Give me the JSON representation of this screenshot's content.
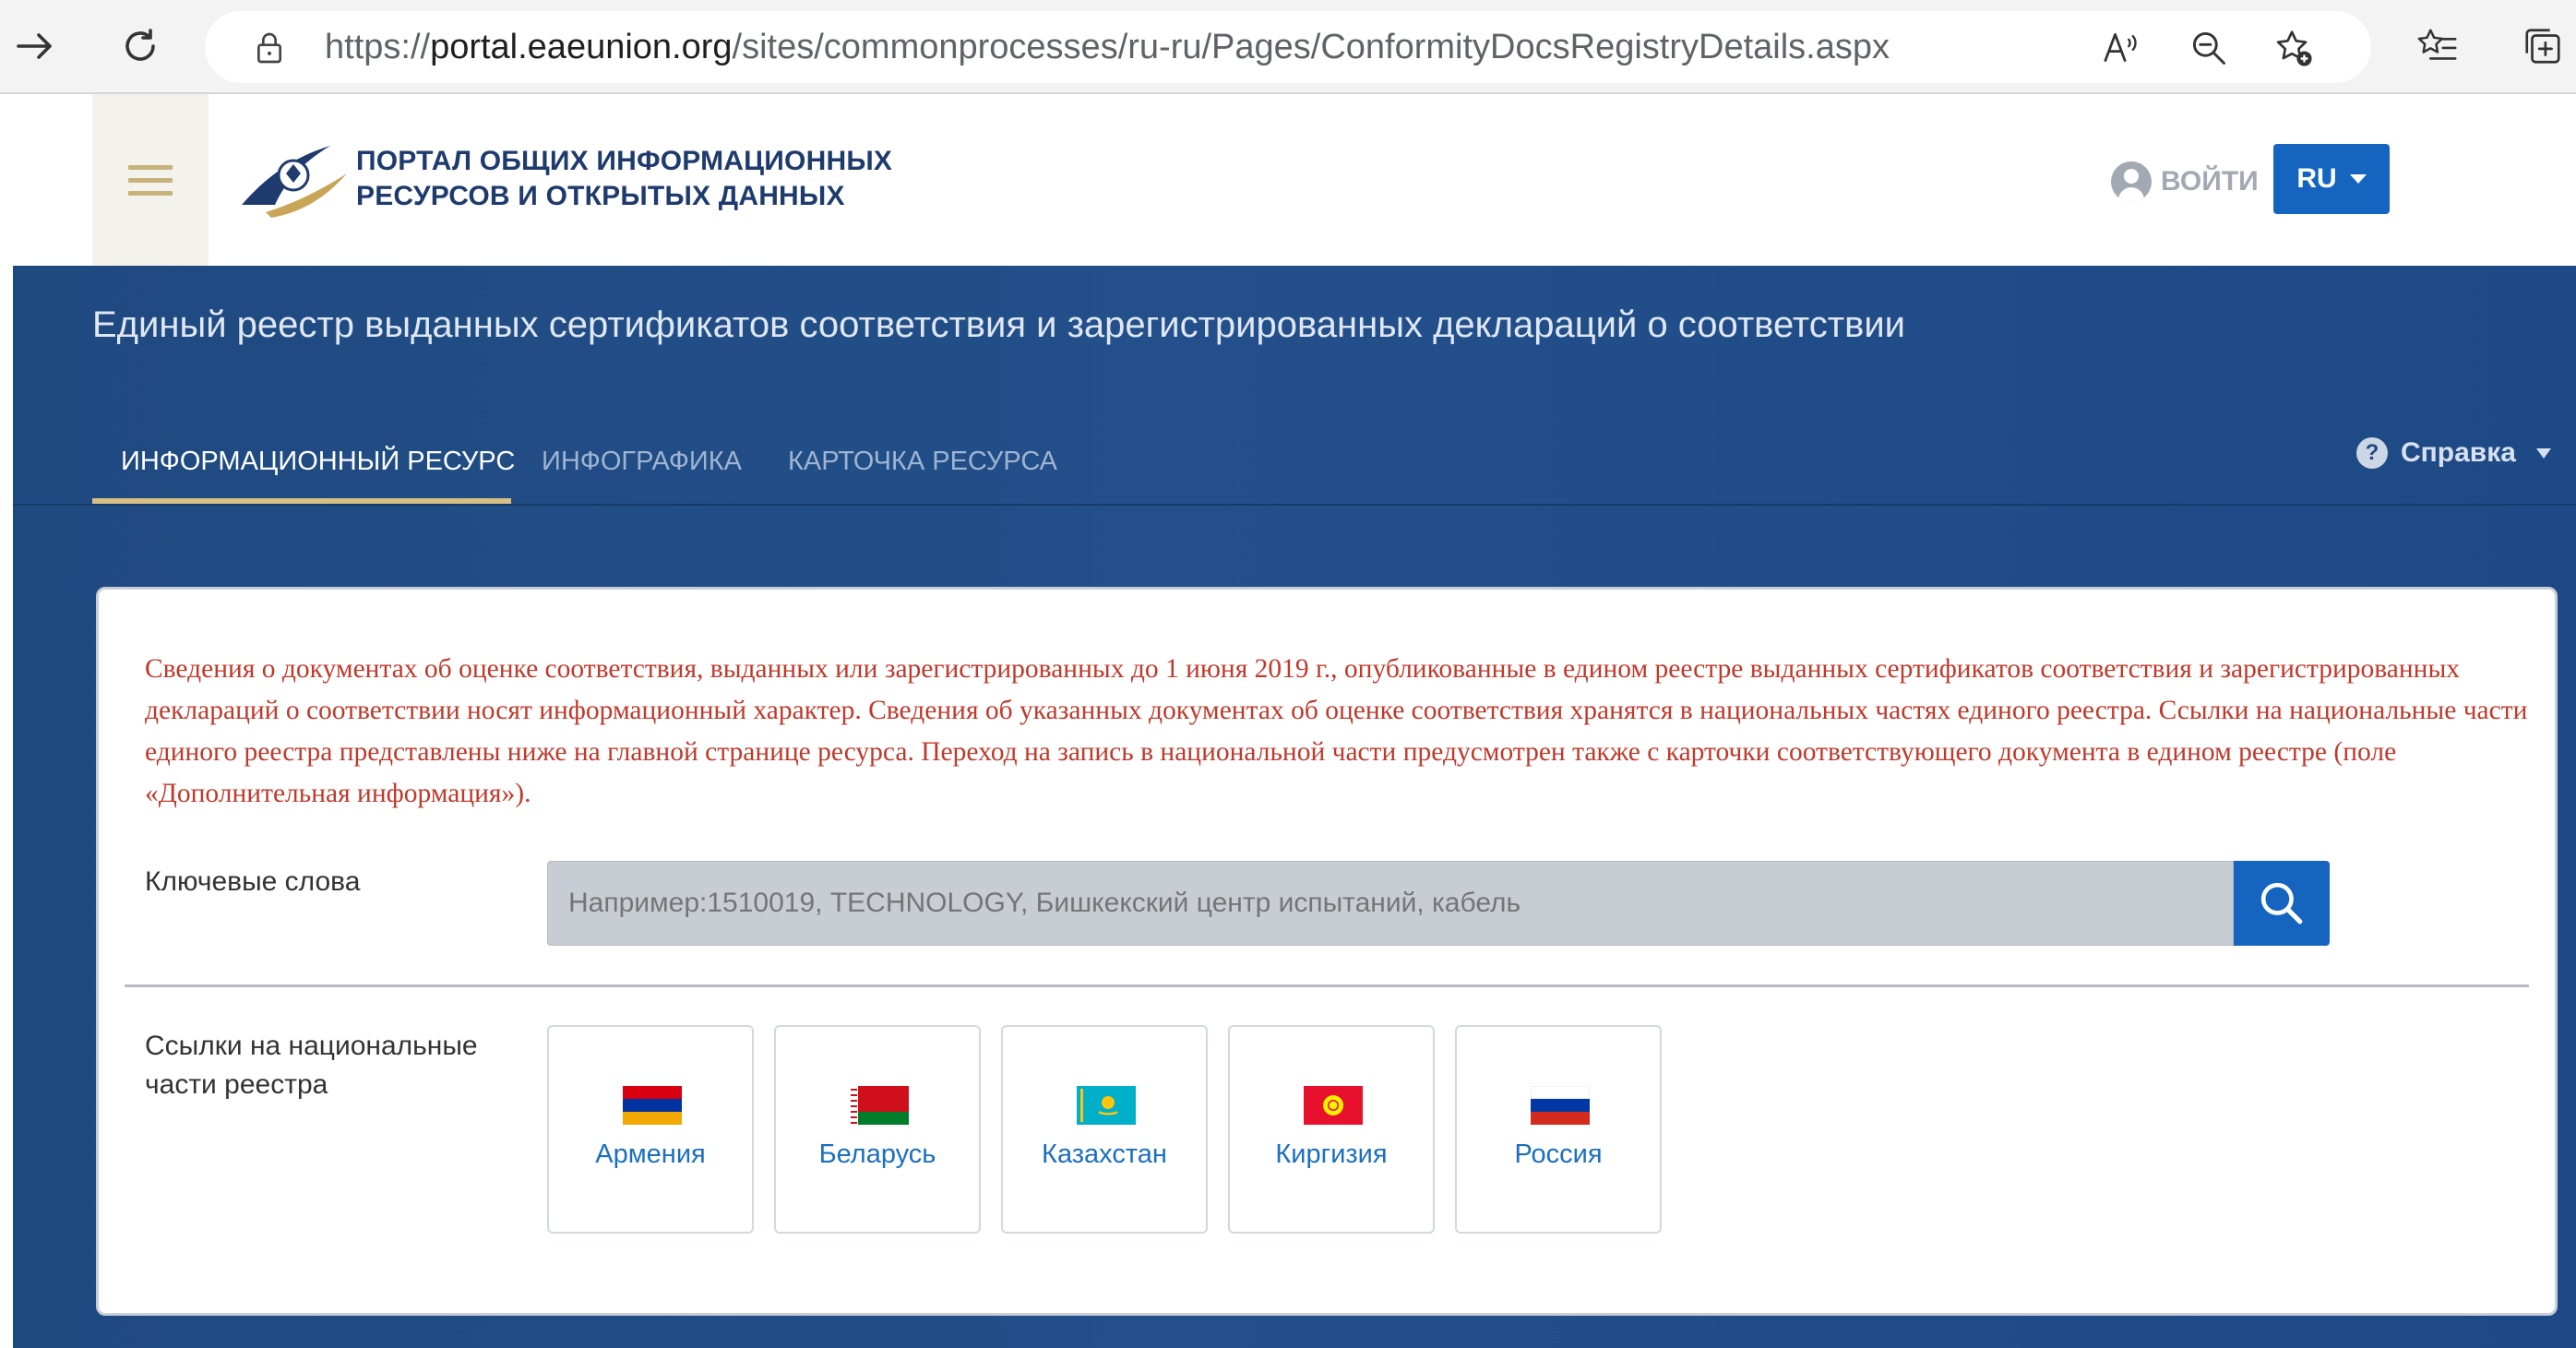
{
  "browser": {
    "url_prefix": "https://",
    "url_host": "portal.eaeunion.org",
    "url_path": "/sites/commonprocesses/ru-ru/Pages/ConformityDocsRegistryDetails.aspx"
  },
  "header": {
    "portal_title": "ПОРТАЛ ОБЩИХ ИНФОРМАЦИОННЫХ\nРЕСУРСОВ И ОТКРЫТЫХ ДАННЫХ",
    "login_label": "ВОЙТИ",
    "lang_label": "RU"
  },
  "band": {
    "title": "Единый реестр выданных сертификатов соответствия и зарегистрированных деклараций о соответствии",
    "tabs": [
      {
        "label": "ИНФОРМАЦИОННЫЙ РЕСУРС",
        "active": true
      },
      {
        "label": "ИНФОГРАФИКА",
        "active": false
      },
      {
        "label": "КАРТОЧКА РЕСУРСА",
        "active": false
      }
    ],
    "help_label": "Справка"
  },
  "card": {
    "notice": "Сведения о документах об оценке соответствия, выданных или зарегистрированных до 1 июня 2019 г., опубликованные в едином реестре выданных сертификатов соответствия и зарегистрированных деклараций о соответствии носят информационный характер. Сведения об указанных документах об оценке соответствия хранятся в национальных частях единого реестра. Ссылки на национальные части единого реестра представлены ниже на главной странице ресурса. Переход на запись в национальной части предусмотрен также с карточки соответствующего документа в едином реестре (поле «Дополнительная информация»).",
    "keywords_label": "Ключевые слова",
    "search_placeholder": "Например:1510019, TECHNOLOGY, Бишкекский центр испытаний, кабель",
    "links_label": "Ссылки на национальные\nчасти реестра",
    "countries": [
      {
        "name": "Армения",
        "flag": "armenia-flag"
      },
      {
        "name": "Беларусь",
        "flag": "belarus-flag"
      },
      {
        "name": "Казахстан",
        "flag": "kazakhstan-flag"
      },
      {
        "name": "Киргизия",
        "flag": "kyrgyzstan-flag"
      },
      {
        "name": "Россия",
        "flag": "russia-flag"
      }
    ]
  },
  "colors": {
    "accent_blue": "#1565c0",
    "band_blue": "#234f8a",
    "tab_underline": "#d6bf85",
    "notice_red": "#c0392b",
    "country_link": "#1a6fc1"
  }
}
